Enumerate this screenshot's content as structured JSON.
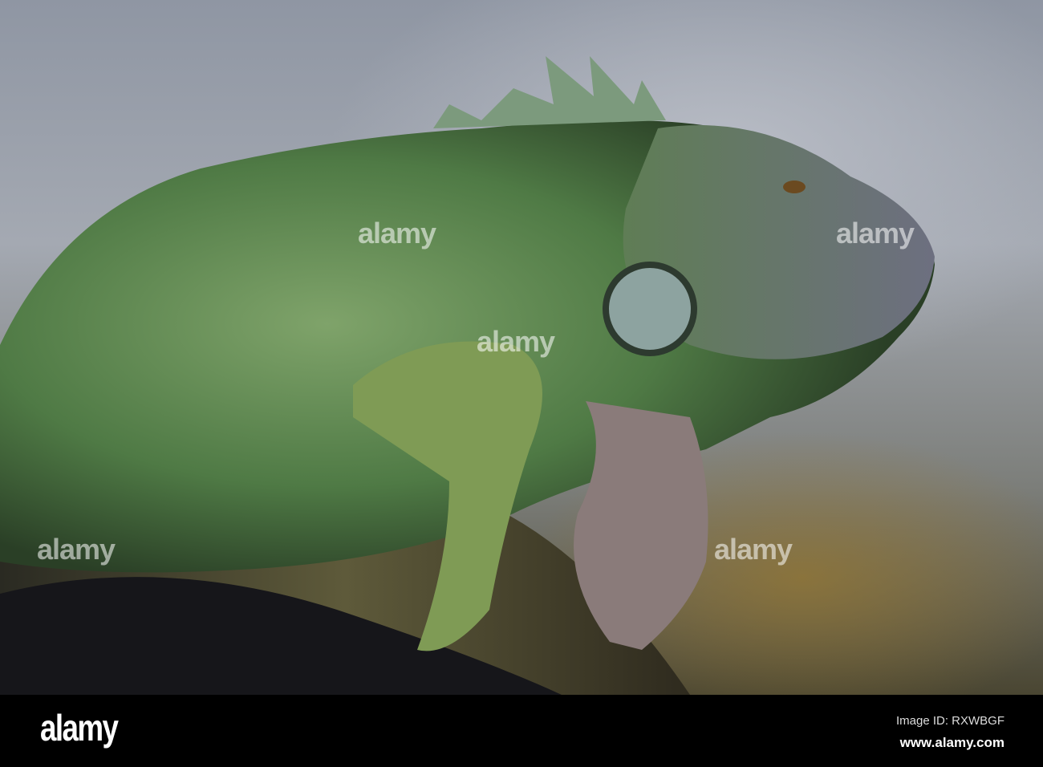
{
  "watermark": {
    "text": "alamy"
  },
  "footer": {
    "logo": "alamy",
    "image_id": "Image ID: RXWBGF",
    "url": "www.alamy.com"
  }
}
